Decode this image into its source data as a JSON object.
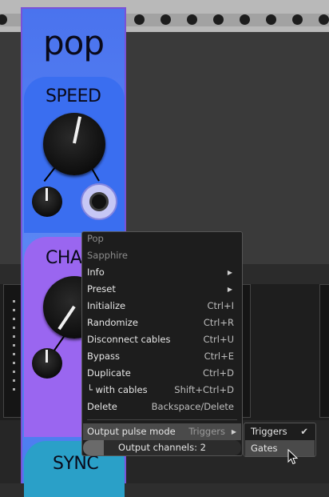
{
  "module": {
    "title": "pop",
    "sections": {
      "speed": "SPEED",
      "chaos": "CHA",
      "sync": "SYNC"
    }
  },
  "context_menu": {
    "header_items": [
      {
        "label": "Pop"
      },
      {
        "label": "Sapphire"
      }
    ],
    "items": [
      {
        "label": "Info",
        "shortcut": "",
        "submenu": true
      },
      {
        "label": "Preset",
        "shortcut": "",
        "submenu": true
      },
      {
        "label": "Initialize",
        "shortcut": "Ctrl+I",
        "submenu": false
      },
      {
        "label": "Randomize",
        "shortcut": "Ctrl+R",
        "submenu": false
      },
      {
        "label": "Disconnect cables",
        "shortcut": "Ctrl+U",
        "submenu": false
      },
      {
        "label": "Bypass",
        "shortcut": "Ctrl+E",
        "submenu": false
      },
      {
        "label": "Duplicate",
        "shortcut": "Ctrl+D",
        "submenu": false
      },
      {
        "label": "└ with cables",
        "shortcut": "Shift+Ctrl+D",
        "submenu": false
      },
      {
        "label": "Delete",
        "shortcut": "Backspace/Delete",
        "submenu": false
      }
    ],
    "output_pulse_mode": {
      "label": "Output pulse mode",
      "value": "Triggers"
    },
    "output_channels": {
      "label": "Output channels: 2",
      "value": 2
    }
  },
  "submenu": {
    "items": [
      {
        "label": "Triggers",
        "checked": "✔"
      },
      {
        "label": "Gates",
        "checked": ""
      }
    ]
  },
  "colors": {
    "module_blue": "#4a73ee",
    "speed_panel": "#3a6ef0",
    "chaos_panel": "#9a66f0",
    "sync_panel": "#2aa0c8",
    "menu_bg": "#1d1d1d",
    "menu_highlight": "#4a4a4a"
  }
}
